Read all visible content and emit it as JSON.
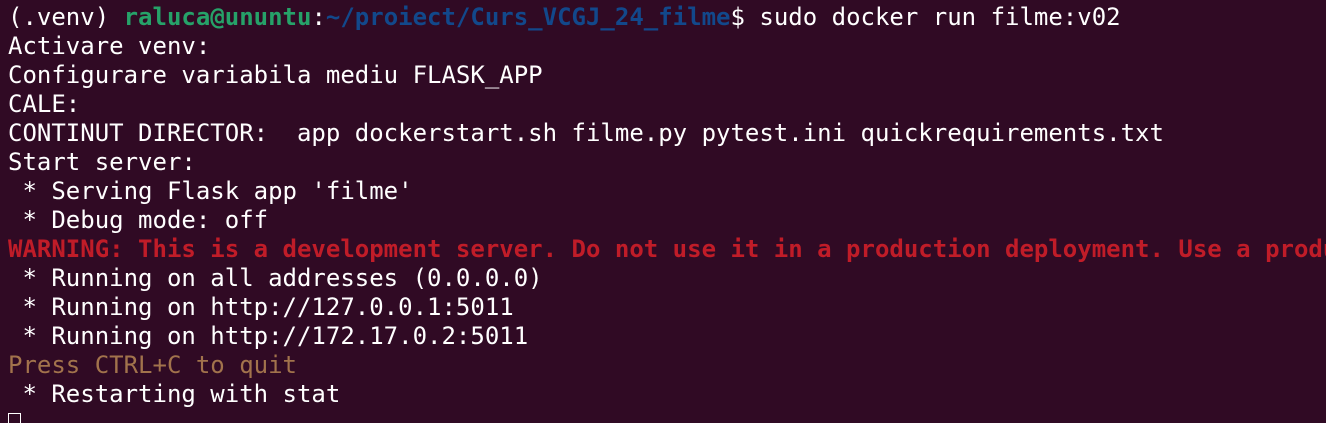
{
  "colors": {
    "background": "#300a24",
    "foreground": "#ffffff",
    "user_host": "#26a269",
    "path": "#12488b",
    "warning": "#c01c28",
    "hint": "#a2734c"
  },
  "prompt": {
    "venv": "(.venv) ",
    "user_host": "raluca@ununtu",
    "separator": ":",
    "path": "~/proiect/Curs_VCGJ_24_filme",
    "symbol": "$ ",
    "command": "sudo docker run filme:v02"
  },
  "output": {
    "line_1": "Activare venv:",
    "line_2": "Configurare variabila mediu FLASK_APP",
    "line_3": "CALE:",
    "line_4": "CONTINUT DIRECTOR:  app dockerstart.sh filme.py pytest.ini quickrequirements.txt",
    "line_5": "Start server:",
    "line_6": " * Serving Flask app 'filme'",
    "line_7": " * Debug mode: off",
    "warning": "WARNING: This is a development server. Do not use it in a production deployment. Use a production WSGI server instead.",
    "line_9": " * Running on all addresses (0.0.0.0)",
    "line_10": " * Running on http://127.0.0.1:5011",
    "line_11": " * Running on http://172.17.0.2:5011",
    "hint": "Press CTRL+C to quit",
    "line_13": " * Restarting with stat"
  }
}
